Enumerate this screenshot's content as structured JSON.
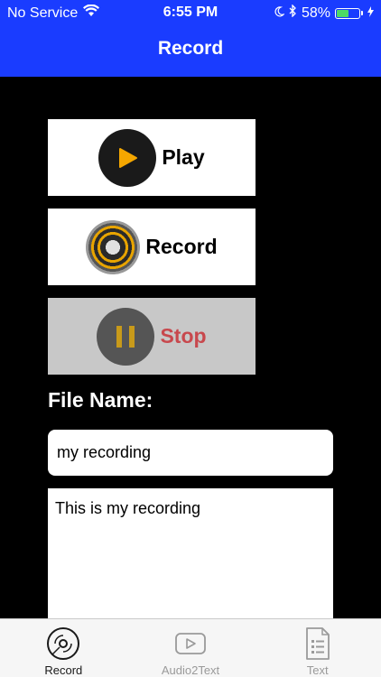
{
  "status_bar": {
    "carrier": "No Service",
    "time": "6:55 PM",
    "battery_percent": "58%",
    "battery_level": 0.58
  },
  "nav": {
    "title": "Record"
  },
  "buttons": {
    "play_label": "Play",
    "record_label": "Record",
    "stop_label": "Stop"
  },
  "file": {
    "label": "File Name:",
    "name_value": "my recording",
    "notes_value": "This is my recording"
  },
  "tabs": [
    {
      "label": "Record",
      "icon": "disc-icon",
      "active": true
    },
    {
      "label": "Audio2Text",
      "icon": "video-icon",
      "active": false
    },
    {
      "label": "Text",
      "icon": "document-icon",
      "active": false
    }
  ],
  "colors": {
    "header": "#1a3cff",
    "accent_play": "#f5a700",
    "stop_text": "#c8484d",
    "battery": "#4cd964"
  }
}
